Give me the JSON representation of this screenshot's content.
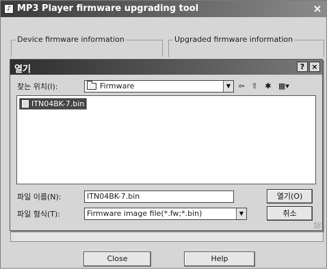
{
  "window": {
    "title": "MP3 Player firmware upgrading tool",
    "close_glyph": "×",
    "app_icon": "app-icon"
  },
  "groups": {
    "device_label": "Device firmware information",
    "upgraded_label": "Upgraded firmware information"
  },
  "buttons": {
    "close_label": "Close",
    "help_label": "Help"
  },
  "dialog": {
    "title": "열기",
    "help_glyph": "?",
    "close_glyph": "×",
    "look_in_label": "찾는 위치(I):",
    "look_in_value": "Firmware",
    "toolbar": {
      "back_glyph": "⇦",
      "up_glyph": "⇧",
      "new_folder_glyph": "✱",
      "view_glyph": "▦▾"
    },
    "files": [
      {
        "name": "ITN04BK-7.bin",
        "selected": true
      }
    ],
    "file_name_label": "파일 이름(N):",
    "file_name_value": "ITN04BK-7.bin",
    "file_type_label": "파일 형식(T):",
    "file_type_value": "Firmware image file(*.fw;*.bin)",
    "open_label": "열기(O)",
    "cancel_label": "취소"
  },
  "colors": {
    "title_bar_start": "#3a3a3a",
    "window_face": "#d6d6d6",
    "selection": "#444444"
  }
}
